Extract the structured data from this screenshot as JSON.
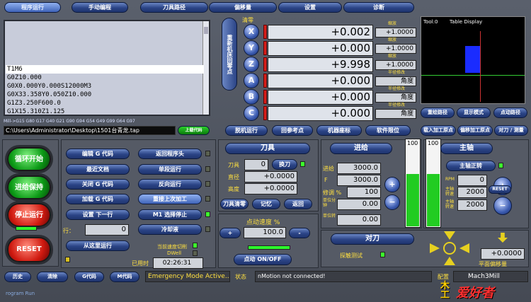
{
  "tabs": [
    "程序运行",
    "手动编程",
    "刀具路径",
    "偏移量",
    "设置",
    "诊断"
  ],
  "gcode": {
    "lines": [
      "T1M6",
      "G0Z10.000",
      "G0X0.000Y0.000S12000M3",
      "G0X33.358Y0.050Z10.000",
      "G1Z3.250F600.0",
      "G1X15.310Z1.125"
    ],
    "highlight_index": 0
  },
  "modal_line": "Mill->G15  G80 G17 G40 G21 G90 G94 G54 G49 G99 G64 G97",
  "file_path": "C:\\Users\\Administrator\\Desktop\\1501台青龙.tap",
  "load_button": "上载代码",
  "ref_button": "重新机床回零点",
  "ref_label": "清零",
  "axes": [
    {
      "name": "X",
      "value": "+0.002",
      "scale_label": "缩放",
      "scale": "+1.0000"
    },
    {
      "name": "Y",
      "value": "+0.000",
      "scale_label": "缩放",
      "scale": "+1.0000"
    },
    {
      "name": "Z",
      "value": "+9.998",
      "scale_label": "缩放",
      "scale": "+1.0000"
    },
    {
      "name": "A",
      "value": "+0.000",
      "scale_label": "半径修改",
      "scale": "角度"
    },
    {
      "name": "B",
      "value": "+0.000",
      "scale_label": "半径修改",
      "scale": "角度"
    },
    {
      "name": "C",
      "value": "+0.000",
      "scale_label": "半径修改",
      "scale": "角度"
    }
  ],
  "axis_buttons": [
    "脱机运行",
    "回参考点",
    "机器座标",
    "软件限位"
  ],
  "toolpath": {
    "tool": "Tool:0",
    "title": "Table Display"
  },
  "display_buttons": [
    "重绘路径",
    "显示模式",
    "点动路径"
  ],
  "display_buttons2": [
    "载入加工原点",
    "偏移加工原点",
    "对刀 / 测量"
  ],
  "run": {
    "start": "循环开始",
    "hold": "进给保持",
    "stop": "停止运行",
    "reset": "RESET"
  },
  "program_buttons_left": [
    "编辑 G 代码",
    "最近文档",
    "关闭 G 代码",
    "加载 G 代码",
    "设置 下一行",
    "从这里运行"
  ],
  "program_buttons_right": [
    "返回程序头",
    "单段运行",
    "反向运行",
    "重接上次加工",
    "M1 选择停止",
    "冷却液"
  ],
  "line_label": "行：",
  "line_value": "0",
  "dwell": {
    "feed_label": "当前速度切削",
    "dwell_label": "DWell",
    "time_label": "已用时",
    "time": "02:26:31"
  },
  "tool": {
    "title": "刀具",
    "tool_label": "刀具",
    "tool_value": "0",
    "change": "换刀",
    "dia_label": "直径",
    "dia": "+0.0000",
    "height_label": "高度",
    "height": "+0.0000",
    "buttons": [
      "刀具清零",
      "记忆",
      "返回"
    ]
  },
  "jog": {
    "title": "点动速度 %",
    "value": "100.0",
    "plus": "+",
    "minus": "-",
    "toggle": "点动 ON/OFF"
  },
  "feed": {
    "title": "进给",
    "feed_label": "进给",
    "feed": "3000.0",
    "f_label": "F",
    "f": "3000.0",
    "ovr_label": "修调 %",
    "ovr": "100",
    "unit1": "单位分钟",
    "unit1_val": "0.00",
    "unit2": "单位转",
    "unit2_val": "0.00",
    "bar": "100",
    "bar_level": 1.0
  },
  "spindle": {
    "title": "主轴",
    "cw": "主轴正转",
    "rpm_label": "RPM",
    "rpm": "0",
    "s1": "主轴转速",
    "s1_val": "2000",
    "s2": "主轴转速",
    "s2_val": "2000",
    "reset": "RESET",
    "bar": "100",
    "bar_level": 1.0
  },
  "probe": {
    "title": "对刀",
    "label": "探触测试"
  },
  "offset": {
    "label": "平面偏移量",
    "value": "+0.0000"
  },
  "bottom_buttons": [
    "历史",
    "清除",
    "G代码",
    "M代码"
  ],
  "status_msg": "Emergency Mode Active...",
  "status_label": "状态",
  "status_text": "nMotion not connected!",
  "profile_label": "配置",
  "profile": "Mach3Mill",
  "watermark": "rogram Run",
  "logo": "爱好者",
  "logo_mark": "木工"
}
